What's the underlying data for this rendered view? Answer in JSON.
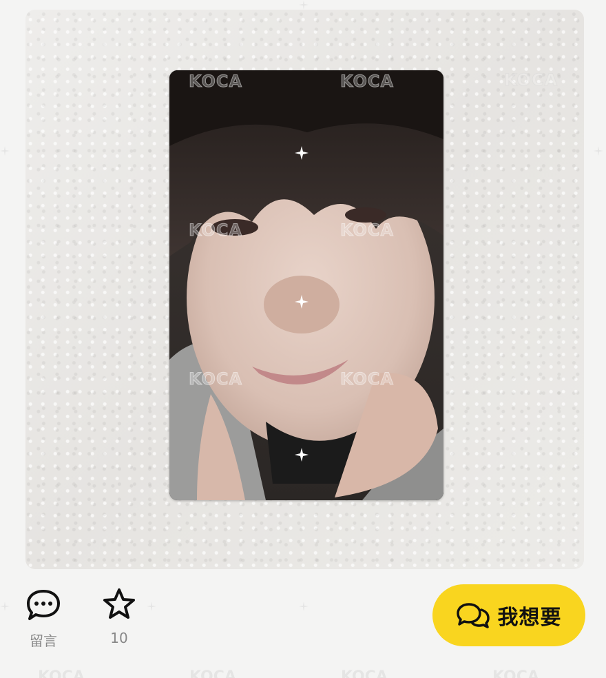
{
  "photo": {
    "watermark_text": "KOCA",
    "description_icon": "photocard-image"
  },
  "actions": {
    "comment": {
      "label": "留言",
      "icon": "comment-icon"
    },
    "favorite": {
      "count": "10",
      "icon": "star-icon"
    }
  },
  "want_button": {
    "label": "我想要",
    "icon": "chat-bubbles-icon",
    "color": "#f9d51f"
  },
  "colors": {
    "background": "#f4f4f3",
    "accent": "#f9d51f",
    "label_gray": "#888888"
  }
}
